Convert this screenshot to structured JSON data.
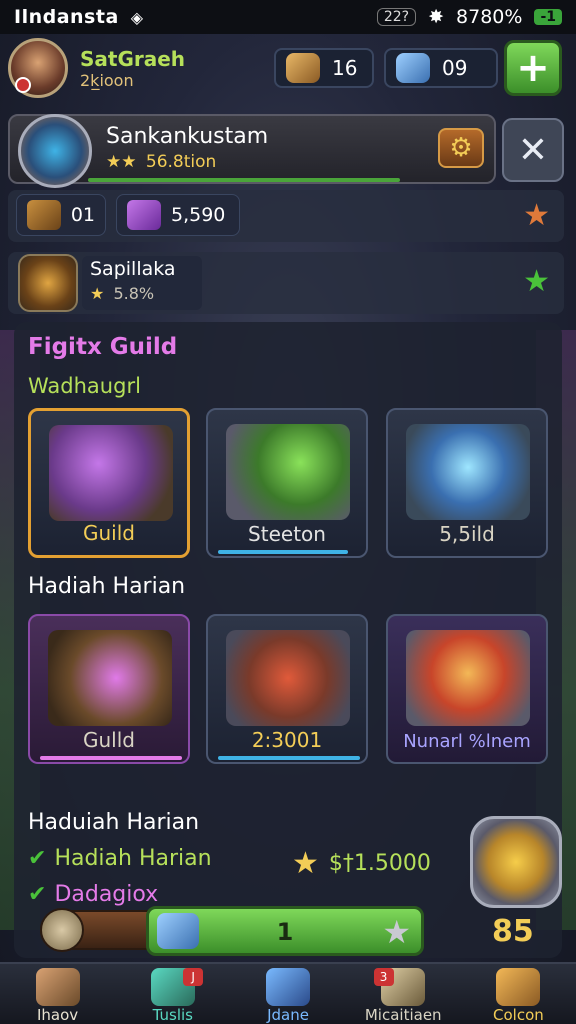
{
  "status_bar": {
    "title": "Ilndansta",
    "diamond_icon": "diamond-icon",
    "signal": "22?",
    "gear_icon": "gear-icon",
    "percent": "8780%",
    "battery": "-1"
  },
  "player": {
    "name": "SatGraeh",
    "subtitle": "2k̲ioon",
    "avatar_icon": "warrior-avatar"
  },
  "resources": {
    "scroll": {
      "icon": "scroll-icon",
      "value": "16"
    },
    "gem": {
      "icon": "gem-icon",
      "value": "09"
    },
    "add_icon": "plus-icon"
  },
  "banner": {
    "title": "Sankankustam",
    "stars": "★★",
    "sub": "56.8tion",
    "emblem_icon": "crystal-shield-icon",
    "settings_icon": "gear-icon",
    "close_icon": "close-icon",
    "progress": 0.82
  },
  "counters": {
    "chest": {
      "icon": "chest-icon",
      "value": "01"
    },
    "potion": {
      "icon": "potion-icon",
      "value": "5,590"
    },
    "star_icon": "orange-star-icon"
  },
  "guild_row": {
    "title": "Sapillaka",
    "star": "★",
    "sub": "5.8%",
    "emblem_icon": "guild-emblem-icon",
    "star_icon": "green-star-icon"
  },
  "guild_section": {
    "title": "Figitx Guild",
    "subtitle": "Wadhaugrl",
    "cards": [
      {
        "label": "Guild",
        "icon": "scissors-crystal-icon"
      },
      {
        "label": "Steeton",
        "icon": "glowing-sword-icon"
      },
      {
        "label": "5,5ild",
        "icon": "magic-chest-icon"
      }
    ]
  },
  "daily_section": {
    "title": "Hadiah Harian",
    "cards": [
      {
        "label": "Gulld",
        "icon": "crystal-chest-icon"
      },
      {
        "label": "2:3001",
        "icon": "gem-chest-icon"
      },
      {
        "label": "Nunarl %lnem",
        "icon": "golden-chest-icon"
      }
    ]
  },
  "rewards": {
    "title": "Haduiah Harian",
    "items": [
      {
        "check": "✔",
        "label": "Hadiah Harian"
      },
      {
        "check": "✔",
        "label": "Dadagiox"
      }
    ],
    "amount_star": "★",
    "amount": "$†1.5000",
    "emblem_icon": "gold-crystal-icon",
    "count": "85",
    "claim_value": "1",
    "claim_star": "★"
  },
  "nav": [
    {
      "label": "Ihaov",
      "icon": "home-icon",
      "badge": ""
    },
    {
      "label": "Tuslis",
      "icon": "map-icon",
      "badge": "J"
    },
    {
      "label": "Jdane",
      "icon": "crystal-icon",
      "badge": ""
    },
    {
      "label": "Micaitiaen",
      "icon": "shop-icon",
      "badge": "3"
    },
    {
      "label": "Colcon",
      "icon": "gear-icon",
      "badge": ""
    }
  ]
}
